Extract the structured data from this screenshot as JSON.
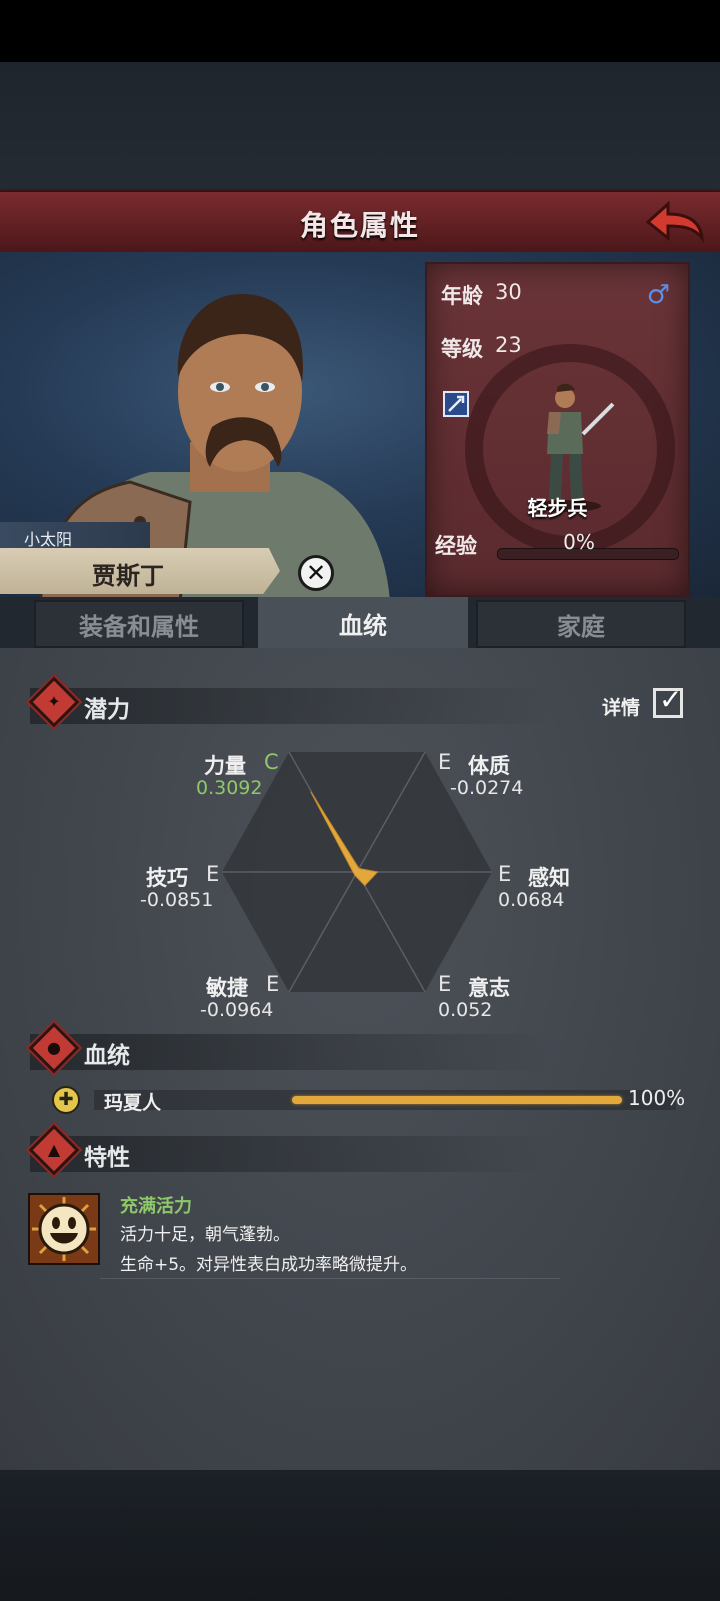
{
  "title": "角色属性",
  "character": {
    "nickname": "小太阳",
    "name": "贾斯丁",
    "age_label": "年龄",
    "age": "30",
    "gender_symbol": "♂",
    "level_label": "等级",
    "level": "23",
    "unit_type": "轻步兵",
    "exp_label": "经验",
    "exp_value": "0%"
  },
  "tabs": [
    {
      "label": "装备和属性",
      "active": false
    },
    {
      "label": "血统",
      "active": true
    },
    {
      "label": "家庭",
      "active": false
    }
  ],
  "potential": {
    "title": "潜力",
    "detail_label": "详情",
    "detail_checked": true,
    "stats": [
      {
        "name": "力量",
        "grade": "C",
        "value": "0.3092"
      },
      {
        "name": "体质",
        "grade": "E",
        "value": "-0.0274"
      },
      {
        "name": "感知",
        "grade": "E",
        "value": "0.0684"
      },
      {
        "name": "意志",
        "grade": "E",
        "value": "0.052"
      },
      {
        "name": "敏捷",
        "grade": "E",
        "value": "-0.0964"
      },
      {
        "name": "技巧",
        "grade": "E",
        "value": "-0.0851"
      }
    ]
  },
  "bloodline": {
    "title": "血统",
    "entries": [
      {
        "name": "玛夏人",
        "percent": "100%",
        "fraction": 1.0
      }
    ]
  },
  "traits": {
    "title": "特性",
    "items": [
      {
        "name": "充满活力",
        "description": "活力十足，朝气蓬勃。",
        "effect": "生命+5。对异性表白成功率略微提升。"
      }
    ]
  },
  "colors": {
    "accent_red": "#c13a33",
    "good_green": "#8ec86a",
    "bar_gold": "#e3a83b"
  }
}
